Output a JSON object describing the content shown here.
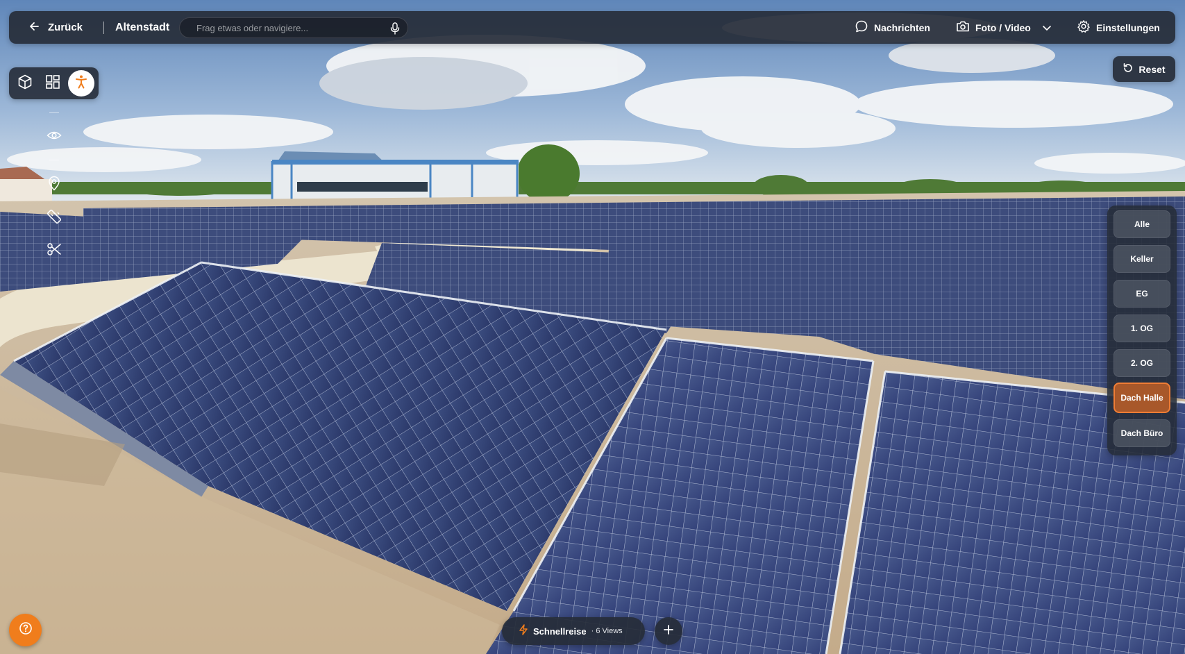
{
  "topbar": {
    "back_label": "Zurück",
    "location": "Altenstadt",
    "search_placeholder": "Frag etwas oder navigiere...",
    "messages_label": "Nachrichten",
    "media_label": "Foto / Video",
    "settings_label": "Einstellungen"
  },
  "viewmodes": {
    "active": "person-view",
    "items": [
      "3d-view",
      "floorplan-view",
      "person-view"
    ]
  },
  "sidetools": [
    "eye-icon",
    "location-pin-icon",
    "ruler-icon",
    "scissors-icon"
  ],
  "reset_label": "Reset",
  "floors": {
    "active": "Dach Halle",
    "items": [
      "Alle",
      "Keller",
      "EG",
      "1. OG",
      "2. OG",
      "Dach Halle",
      "Dach Büro"
    ]
  },
  "quick_travel": {
    "label": "Schnellreise",
    "count": "· 6 Views"
  },
  "colors": {
    "accent": "#f07d1c",
    "active_floor": "#a8582a",
    "panel": "#262c38"
  }
}
